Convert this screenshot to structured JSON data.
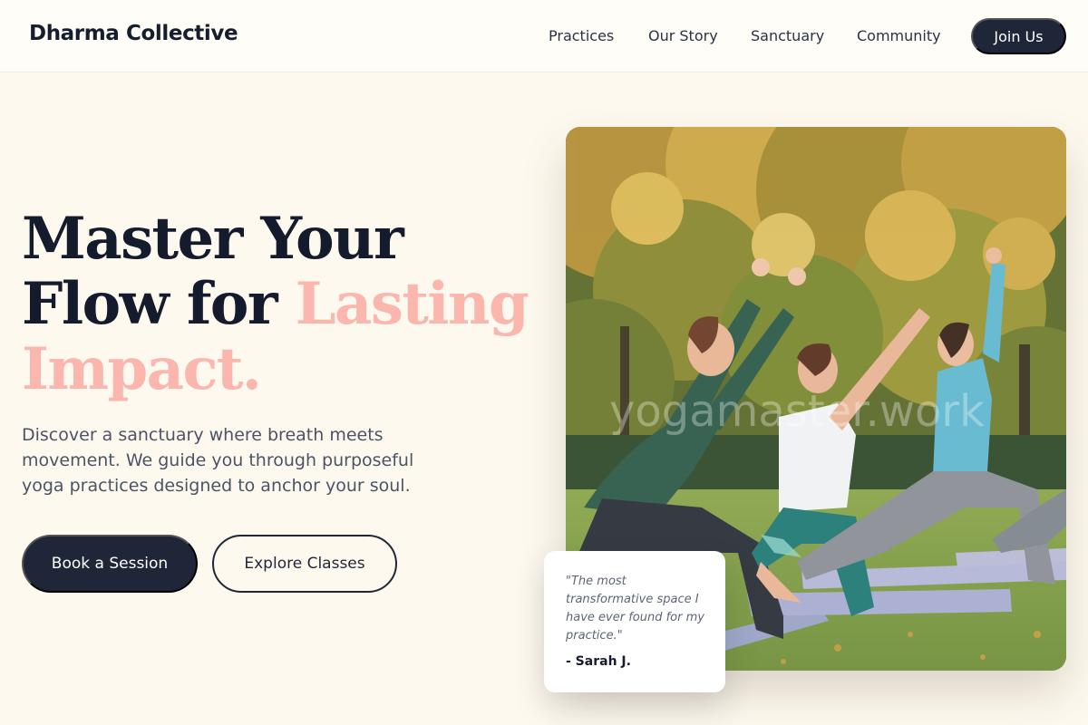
{
  "brand": {
    "name": "Dharma Collective"
  },
  "nav": {
    "links": [
      "Practices",
      "Our Story",
      "Sanctuary",
      "Community"
    ],
    "cta_label": "Join Us"
  },
  "hero": {
    "title_line1": "Master Your",
    "title_line2_dark": "Flow for",
    "title_line2_accent": "Lasting",
    "title_line3_accent": "Impact.",
    "description": "Discover a sanctuary where breath meets movement. We guide you through purposeful yoga practices designed to anchor your soul.",
    "primary_button": "Book a Session",
    "secondary_button": "Explore Classes"
  },
  "image": {
    "watermark": "yogamaster.work"
  },
  "testimonial": {
    "quote": "\"The most transformative space I have ever found for my practice.\"",
    "author": "- Sarah J."
  },
  "colors": {
    "primary_dark": "#1e2638",
    "accent_pink": "#fbb6ae",
    "background_cream": "#fef9ef"
  }
}
